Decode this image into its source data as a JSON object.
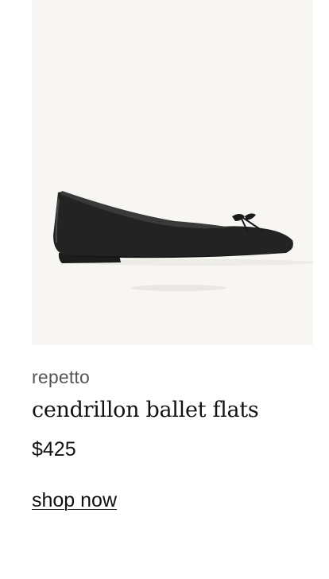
{
  "product": {
    "brand": "repetto",
    "name": "cendrillon ballet flats",
    "price": "$425",
    "cta_label": "shop now",
    "image_semantic": "black-ballet-flat-product-photo",
    "image_background": "#f7f6f2"
  }
}
